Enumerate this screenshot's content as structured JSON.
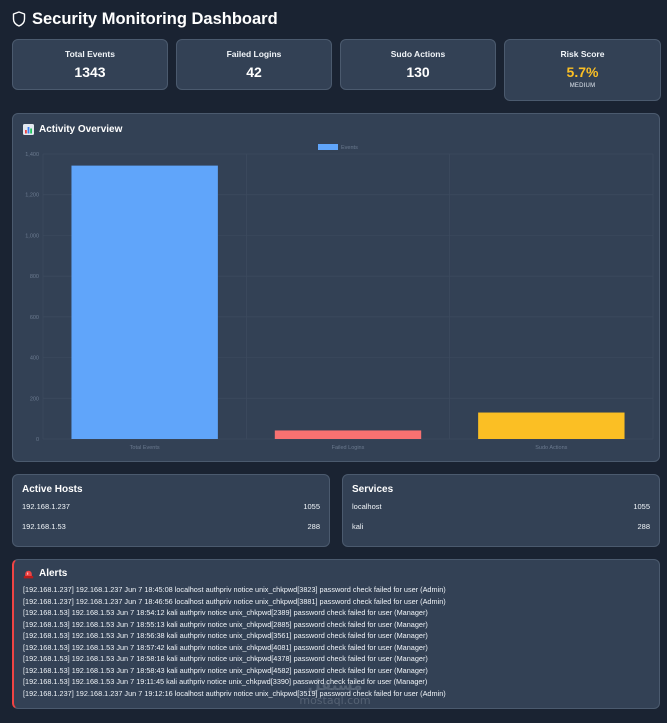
{
  "header": {
    "title": "Security Monitoring Dashboard",
    "icon": "shield-icon"
  },
  "stats": [
    {
      "label": "Total Events",
      "value": "1343"
    },
    {
      "label": "Failed Logins",
      "value": "42"
    },
    {
      "label": "Sudo Actions",
      "value": "130"
    },
    {
      "label": "Risk Score",
      "value": "5.7%",
      "sub": "MEDIUM"
    }
  ],
  "chart_section": {
    "title": "Activity Overview",
    "icon": "bar-chart-icon"
  },
  "chart_data": {
    "type": "bar",
    "categories": [
      "Total Events",
      "Failed Logins",
      "Sudo Actions"
    ],
    "series": [
      {
        "name": "Events",
        "values": [
          1343,
          42,
          130
        ]
      }
    ],
    "bar_colors": [
      "#60a5fa",
      "#f87171",
      "#fbbf24"
    ],
    "ylim": [
      0,
      1400
    ],
    "yticks": [
      0,
      200,
      400,
      600,
      800,
      1000,
      1200,
      1400
    ],
    "ytick_labels": [
      "0",
      "200",
      "400",
      "600",
      "800",
      "1,000",
      "1,200",
      "1,400"
    ],
    "grid": true,
    "legend": "top-center"
  },
  "hosts": {
    "title": "Active Hosts",
    "items": [
      {
        "name": "192.168.1.237",
        "count": "1055"
      },
      {
        "name": "192.168.1.53",
        "count": "288"
      }
    ]
  },
  "services": {
    "title": "Services",
    "items": [
      {
        "name": "localhost",
        "count": "1055"
      },
      {
        "name": "kali",
        "count": "288"
      }
    ]
  },
  "alerts": {
    "title": "Alerts",
    "icon": "alarm-light-icon",
    "items": [
      "[192.168.1.237] 192.168.1.237 Jun 7 18:45:08 localhost authpriv notice unix_chkpwd[3823] password check failed for user (Admin)",
      "[192.168.1.237] 192.168.1.237 Jun 7 18:46:56 localhost authpriv notice unix_chkpwd[3881] password check failed for user (Admin)",
      "[192.168.1.53] 192.168.1.53 Jun 7 18:54:12 kali authpriv notice unix_chkpwd[2389] password check failed for user (Manager)",
      "[192.168.1.53] 192.168.1.53 Jun 7 18:55:13 kali authpriv notice unix_chkpwd[2885] password check failed for user (Manager)",
      "[192.168.1.53] 192.168.1.53 Jun 7 18:56:38 kali authpriv notice unix_chkpwd[3561] password check failed for user (Manager)",
      "[192.168.1.53] 192.168.1.53 Jun 7 18:57:42 kali authpriv notice unix_chkpwd[4081] password check failed for user (Manager)",
      "[192.168.1.53] 192.168.1.53 Jun 7 18:58:18 kali authpriv notice unix_chkpwd[4378] password check failed for user (Manager)",
      "[192.168.1.53] 192.168.1.53 Jun 7 18:58:43 kali authpriv notice unix_chkpwd[4582] password check failed for user (Manager)",
      "[192.168.1.53] 192.168.1.53 Jun 7 19:11:45 kali authpriv notice unix_chkpwd[3390] password check failed for user (Manager)",
      "[192.168.1.237] 192.168.1.237 Jun 7 19:12:16 localhost authpriv notice unix_chkpwd[3519] password check failed for user (Admin)"
    ]
  },
  "watermark": {
    "line1": "مستقل",
    "line2": "mostaql.com"
  }
}
